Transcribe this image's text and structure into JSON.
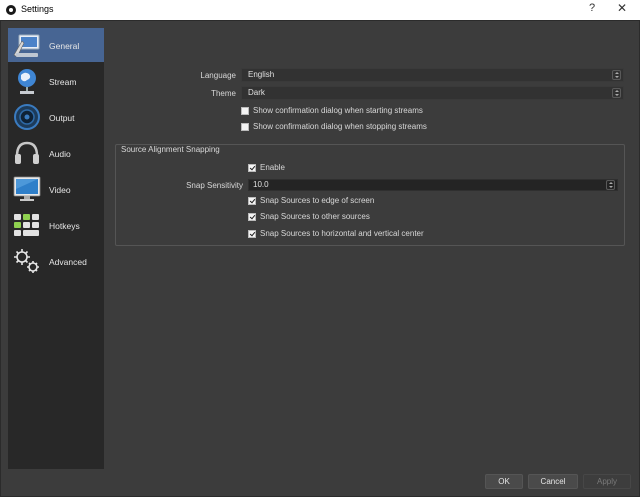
{
  "window": {
    "title": "Settings",
    "help_glyph": "?",
    "close_glyph": "✕"
  },
  "sidebar": {
    "items": [
      {
        "label": "General",
        "icon": "general-icon",
        "active": true
      },
      {
        "label": "Stream",
        "icon": "stream-globe-icon",
        "active": false
      },
      {
        "label": "Output",
        "icon": "output-icon",
        "active": false
      },
      {
        "label": "Audio",
        "icon": "audio-icon",
        "active": false
      },
      {
        "label": "Video",
        "icon": "video-monitor-icon",
        "active": false
      },
      {
        "label": "Hotkeys",
        "icon": "hotkeys-keyboard-icon",
        "active": false
      },
      {
        "label": "Advanced",
        "icon": "advanced-gears-icon",
        "active": false
      }
    ]
  },
  "general": {
    "language_label": "Language",
    "language_value": "English",
    "theme_label": "Theme",
    "theme_value": "Dark",
    "confirm_start_label": "Show confirmation dialog when starting streams",
    "confirm_start_checked": false,
    "confirm_stop_label": "Show confirmation dialog when stopping streams",
    "confirm_stop_checked": false
  },
  "snapping": {
    "group_title": "Source Alignment Snapping",
    "enable_label": "Enable",
    "enable_checked": true,
    "sensitivity_label": "Snap Sensitivity",
    "sensitivity_value": "10.0",
    "edge_label": "Snap Sources to edge of screen",
    "edge_checked": true,
    "other_label": "Snap Sources to other sources",
    "other_checked": true,
    "center_label": "Snap Sources to horizontal and vertical center",
    "center_checked": true
  },
  "buttons": {
    "ok": "OK",
    "cancel": "Cancel",
    "apply": "Apply"
  },
  "colors": {
    "accent": "#476593",
    "background": "#3c3c3c",
    "sidebar": "#282828"
  }
}
